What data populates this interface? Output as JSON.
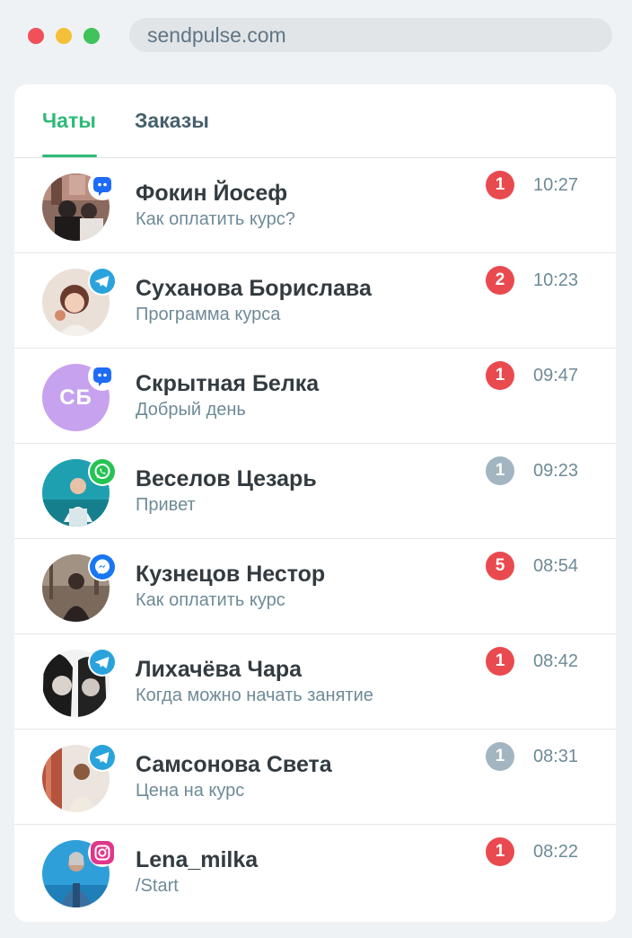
{
  "browser": {
    "url": "sendpulse.com"
  },
  "tabs": {
    "chats": "Чаты",
    "orders": "Заказы"
  },
  "colors": {
    "accent": "#2eba77",
    "unread_badge": "#e94a4f",
    "read_badge": "#a2b5c0",
    "initials_avatar": "#c7a2ef"
  },
  "chats": [
    {
      "name": "Фокин Йосеф",
      "message": "Как оплатить курс?",
      "count": "1",
      "time": "10:27",
      "channel": "chat-bot-icon",
      "badge": "unread"
    },
    {
      "name": "Суханова Борислава",
      "message": "Программа курса",
      "count": "2",
      "time": "10:23",
      "channel": "telegram-icon",
      "badge": "unread"
    },
    {
      "name": "Скрытная Белка",
      "message": "Добрый день",
      "count": "1",
      "time": "09:47",
      "channel": "chat-bot-icon",
      "badge": "unread",
      "initials": "СБ"
    },
    {
      "name": "Веселов Цезарь",
      "message": "Привет",
      "count": "1",
      "time": "09:23",
      "channel": "whatsapp-icon",
      "badge": "read"
    },
    {
      "name": "Кузнецов Нестор",
      "message": "Как оплатить курс",
      "count": "5",
      "time": "08:54",
      "channel": "messenger-icon",
      "badge": "unread"
    },
    {
      "name": "Лихачёва Чара",
      "message": "Когда можно начать занятие",
      "count": "1",
      "time": "08:42",
      "channel": "telegram-icon",
      "badge": "unread"
    },
    {
      "name": "Самсонова Света",
      "message": "Цена на курс",
      "count": "1",
      "time": "08:31",
      "channel": "telegram-icon",
      "badge": "read"
    },
    {
      "name": "Lena_milka",
      "message": "/Start",
      "count": "1",
      "time": "08:22",
      "channel": "instagram-icon",
      "badge": "unread"
    }
  ]
}
